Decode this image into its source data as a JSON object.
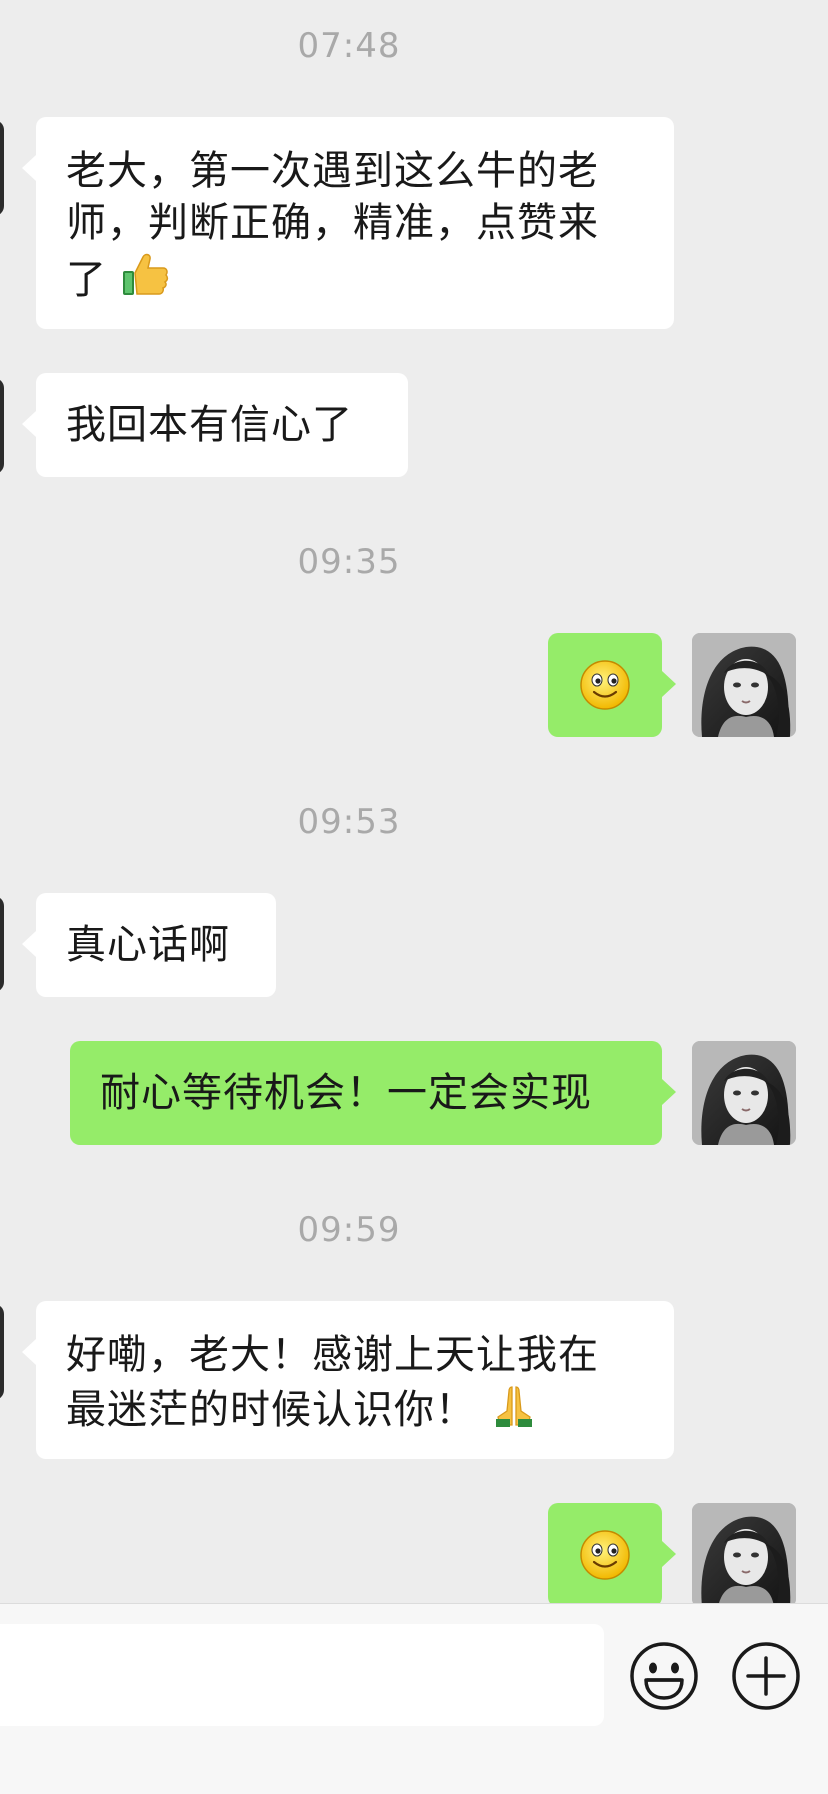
{
  "messages": [
    {
      "type": "timestamp",
      "text": "07:48"
    },
    {
      "type": "incoming",
      "text": "老大，第一次遇到这么牛的老师，判断正确，精准，点赞来了",
      "emoji": "thumbs-up"
    },
    {
      "type": "incoming",
      "text": "我回本有信心了"
    },
    {
      "type": "timestamp",
      "text": "09:35"
    },
    {
      "type": "outgoing",
      "emoji": "smile"
    },
    {
      "type": "timestamp",
      "text": "09:53"
    },
    {
      "type": "incoming",
      "text": "真心话啊"
    },
    {
      "type": "outgoing",
      "text": "耐心等待机会！一定会实现"
    },
    {
      "type": "timestamp",
      "text": "09:59"
    },
    {
      "type": "incoming",
      "text": "好嘞，老大！感谢上天让我在最迷茫的时候认识你！",
      "emoji": "folded-hands"
    },
    {
      "type": "outgoing",
      "emoji": "smile"
    }
  ],
  "lines": {
    "m1_l1": "老大，第一次遇到这么牛的老",
    "m1_l2": "师，判断正确，精准，点赞来",
    "m1_l3": "了",
    "m9_l1": "好嘞，老大！感谢上天让我在",
    "m9_l2": "最迷茫的时候认识你！"
  },
  "input": {
    "placeholder": "",
    "value": ""
  },
  "icons": {
    "emoji_button": "emoji-icon",
    "plus_button": "plus-icon"
  },
  "colors": {
    "background": "#ededed",
    "outgoing_bubble": "#95ec69",
    "incoming_bubble": "#ffffff",
    "timestamp": "#a9a9a9"
  }
}
